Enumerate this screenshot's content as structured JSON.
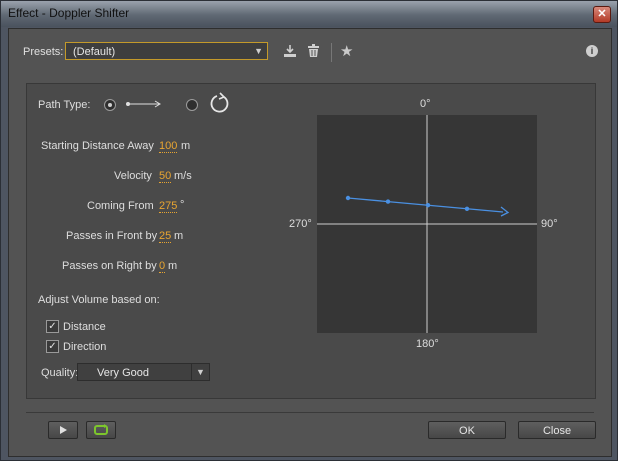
{
  "window": {
    "title": "Effect - Doppler Shifter",
    "close_glyph": "✕"
  },
  "presets": {
    "label": "Presets:",
    "value": "(Default)"
  },
  "path_type": {
    "label": "Path Type:"
  },
  "params": {
    "starting_distance": {
      "label": "Starting Distance Away",
      "value": "100",
      "unit": "m"
    },
    "velocity": {
      "label": "Velocity",
      "value": "50",
      "unit": "m/s"
    },
    "coming_from": {
      "label": "Coming From",
      "value": "275",
      "unit": "°"
    },
    "passes_front": {
      "label": "Passes in Front by",
      "value": "25",
      "unit": "m"
    },
    "passes_right": {
      "label": "Passes on Right by",
      "value": "0",
      "unit": "m"
    }
  },
  "adjust_volume": {
    "label": "Adjust Volume based on:",
    "distance": {
      "label": "Distance",
      "checked": true
    },
    "direction": {
      "label": "Direction",
      "checked": true
    }
  },
  "quality": {
    "label": "Quality:",
    "value": "Very Good"
  },
  "plot": {
    "top": "0°",
    "right": "90°",
    "bottom": "180°",
    "left": "270°",
    "path_color": "#4a90e2"
  },
  "buttons": {
    "ok": "OK",
    "close": "Close"
  },
  "icons": {
    "info": "i",
    "star": "★",
    "save": "save-preset-icon",
    "delete": "trash-icon"
  }
}
